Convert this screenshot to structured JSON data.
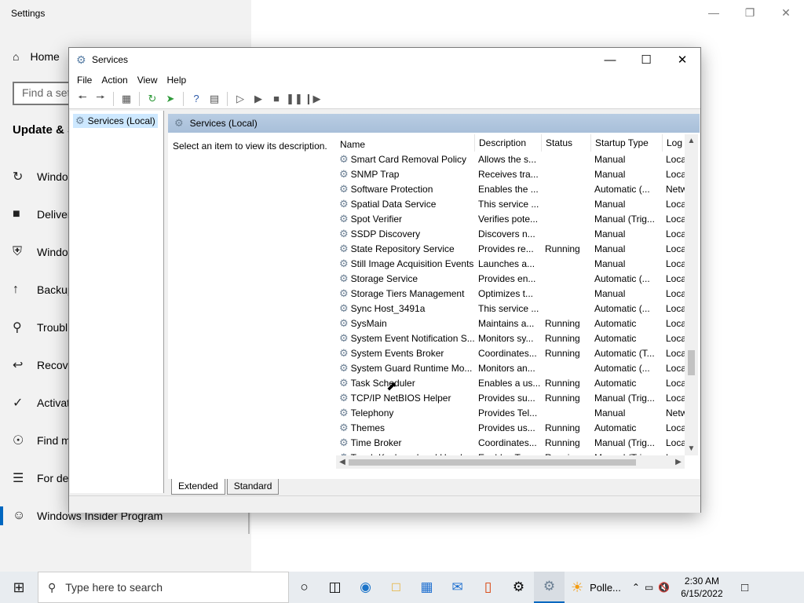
{
  "settings": {
    "title": "Settings",
    "home": "Home",
    "find_placeholder": "Find a set",
    "section": "Update & S",
    "nav": [
      {
        "icon": "refresh-icon",
        "label": "Windo"
      },
      {
        "icon": "delivery-icon",
        "label": "Deliver"
      },
      {
        "icon": "shield-icon",
        "label": "Windo"
      },
      {
        "icon": "backup-icon",
        "label": "Backup"
      },
      {
        "icon": "wrench-icon",
        "label": "Troubl"
      },
      {
        "icon": "recovery-icon",
        "label": "Recove"
      },
      {
        "icon": "check-circle-icon",
        "label": "Activat"
      },
      {
        "icon": "find-device-icon",
        "label": "Find m"
      },
      {
        "icon": "developer-icon",
        "label": "For dev"
      },
      {
        "icon": "insider-icon",
        "label": "Windows Insider Program"
      }
    ]
  },
  "services": {
    "title": "Services",
    "menu": [
      "File",
      "Action",
      "View",
      "Help"
    ],
    "tree_node": "Services (Local)",
    "pane_header": "Services (Local)",
    "description_hint": "Select an item to view its description.",
    "columns": [
      "Name",
      "Description",
      "Status",
      "Startup Type",
      "Log"
    ],
    "rows": [
      [
        "Smart Card Removal Policy",
        "Allows the s...",
        "",
        "Manual",
        "Loca"
      ],
      [
        "SNMP Trap",
        "Receives tra...",
        "",
        "Manual",
        "Loca"
      ],
      [
        "Software Protection",
        "Enables the ...",
        "",
        "Automatic (...",
        "Netw"
      ],
      [
        "Spatial Data Service",
        "This service ...",
        "",
        "Manual",
        "Loca"
      ],
      [
        "Spot Verifier",
        "Verifies pote...",
        "",
        "Manual (Trig...",
        "Loca"
      ],
      [
        "SSDP Discovery",
        "Discovers n...",
        "",
        "Manual",
        "Loca"
      ],
      [
        "State Repository Service",
        "Provides re...",
        "Running",
        "Manual",
        "Loca"
      ],
      [
        "Still Image Acquisition Events",
        "Launches a...",
        "",
        "Manual",
        "Loca"
      ],
      [
        "Storage Service",
        "Provides en...",
        "",
        "Automatic (...",
        "Loca"
      ],
      [
        "Storage Tiers Management",
        "Optimizes t...",
        "",
        "Manual",
        "Loca"
      ],
      [
        "Sync Host_3491a",
        "This service ...",
        "",
        "Automatic (...",
        "Loca"
      ],
      [
        "SysMain",
        "Maintains a...",
        "Running",
        "Automatic",
        "Loca"
      ],
      [
        "System Event Notification S...",
        "Monitors sy...",
        "Running",
        "Automatic",
        "Loca"
      ],
      [
        "System Events Broker",
        "Coordinates...",
        "Running",
        "Automatic (T...",
        "Loca"
      ],
      [
        "System Guard Runtime Mo...",
        "Monitors an...",
        "",
        "Automatic (...",
        "Loca"
      ],
      [
        "Task Scheduler",
        "Enables a us...",
        "Running",
        "Automatic",
        "Loca"
      ],
      [
        "TCP/IP NetBIOS Helper",
        "Provides su...",
        "Running",
        "Manual (Trig...",
        "Loca"
      ],
      [
        "Telephony",
        "Provides Tel...",
        "",
        "Manual",
        "Netw"
      ],
      [
        "Themes",
        "Provides us...",
        "Running",
        "Automatic",
        "Loca"
      ],
      [
        "Time Broker",
        "Coordinates...",
        "Running",
        "Manual (Trig...",
        "Loca"
      ],
      [
        "Touch Keyboard and Hand...",
        "Enables Tou...",
        "Running",
        "Manual (Trig...",
        "Loca"
      ]
    ],
    "tabs": [
      "Extended",
      "Standard"
    ]
  },
  "taskbar": {
    "search_placeholder": "Type here to search",
    "pollen": "Polle...",
    "time": "2:30 AM",
    "date": "6/15/2022"
  }
}
